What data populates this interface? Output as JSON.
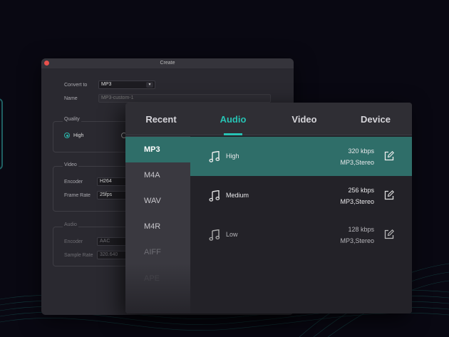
{
  "create_window": {
    "title": "Create",
    "convert_to_label": "Convert to",
    "convert_to_value": "MP3",
    "name_label": "Name",
    "name_value": "MP3-custom-1",
    "quality_title": "Quality",
    "quality_high_label": "High",
    "video_title": "Video",
    "encoder_label": "Encoder",
    "encoder_value": "H264",
    "frame_rate_label": "Frame Rate",
    "frame_rate_value": "25fps",
    "audio_title": "Audio",
    "audio_encoder_label": "Encoder",
    "audio_encoder_value": "AAC",
    "sample_rate_label": "Sample Rate",
    "sample_rate_value": "320.640"
  },
  "tabs": [
    {
      "label": "Recent",
      "active": false
    },
    {
      "label": "Audio",
      "active": true
    },
    {
      "label": "Video",
      "active": false
    },
    {
      "label": "Device",
      "active": false
    }
  ],
  "formats": [
    "MP3",
    "M4A",
    "WAV",
    "M4R",
    "AIFF",
    "APE"
  ],
  "selected_format": "MP3",
  "presets": [
    {
      "name": "High",
      "bitrate": "320 kbps",
      "codec": "MP3,Stereo",
      "selected": true
    },
    {
      "name": "Medium",
      "bitrate": "256 kbps",
      "codec": "MP3,Stereo",
      "selected": false
    },
    {
      "name": "Low",
      "bitrate": "128 kbps",
      "codec": "MP3,Stereo",
      "selected": false
    }
  ],
  "icons": {
    "preset_icon": "music-note-icon",
    "edit_icon": "edit-icon",
    "close_icon": "close-dot-icon",
    "dropdown_icon": "chevron-down-icon"
  },
  "colors": {
    "accent": "#27c3b4",
    "selected_bg": "#2f6e69",
    "background": "#090812"
  }
}
